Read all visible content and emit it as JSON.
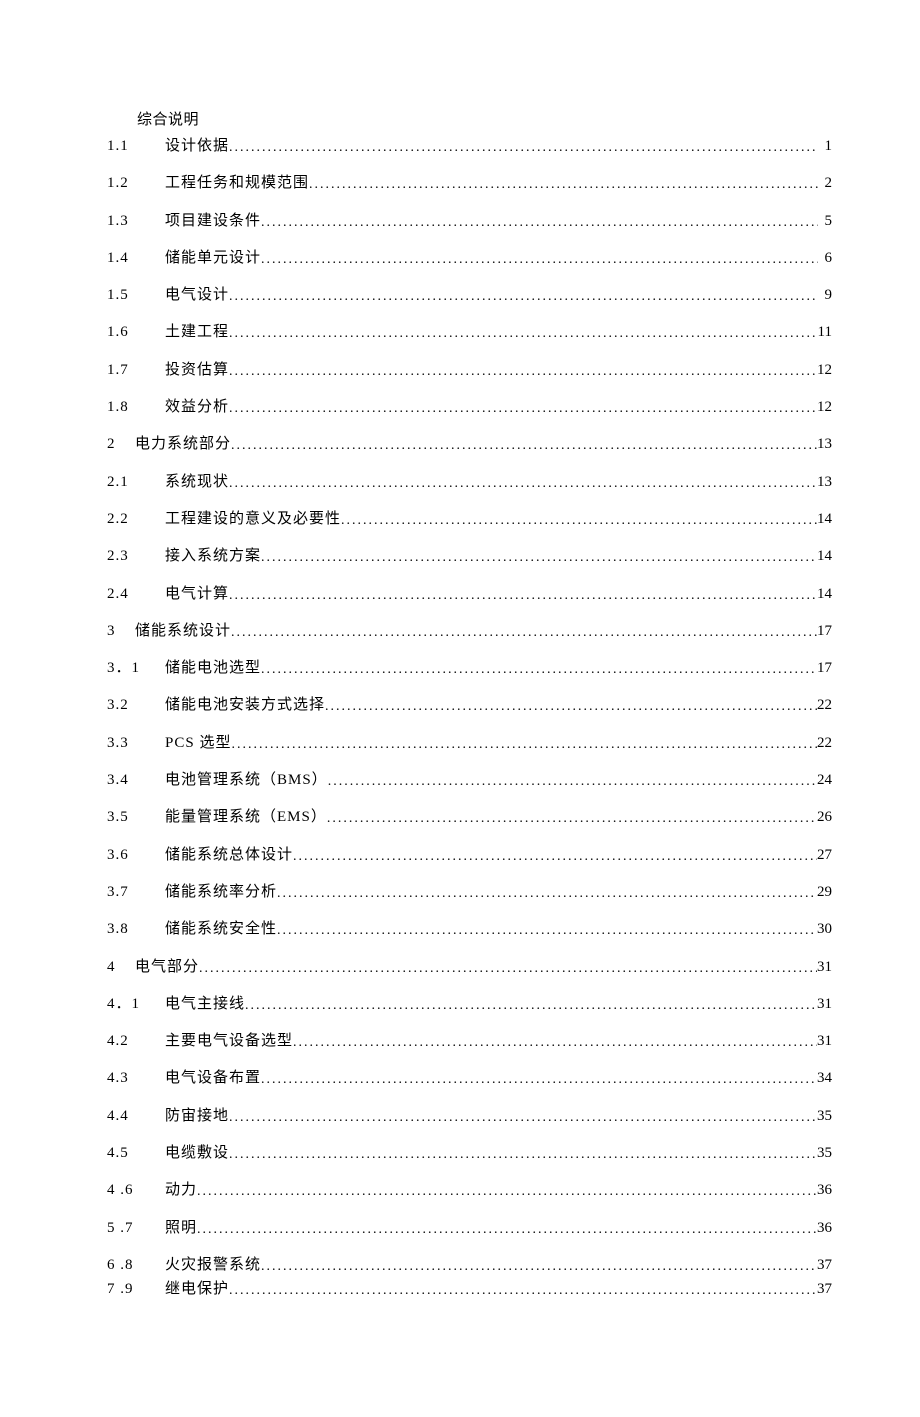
{
  "heading": "综合说明",
  "toc": [
    {
      "num": "1.1",
      "title": "设计依据",
      "page": "1",
      "type": "sub"
    },
    {
      "num": "1.2",
      "title": "工程任务和规模范围",
      "page": "2",
      "type": "sub"
    },
    {
      "num": "1.3",
      "title": "项目建设条件",
      "page": "5",
      "type": "sub"
    },
    {
      "num": "1.4",
      "title": "储能单元设计",
      "page": "6",
      "type": "sub"
    },
    {
      "num": "1.5",
      "title": "电气设计",
      "page": "9",
      "type": "sub"
    },
    {
      "num": "1.6",
      "title": "土建工程",
      "page": "11",
      "type": "sub"
    },
    {
      "num": "1.7",
      "title": "投资估算",
      "page": "12",
      "type": "sub"
    },
    {
      "num": "1.8",
      "title": "效益分析",
      "page": "12",
      "type": "sub"
    },
    {
      "num": "2",
      "title": "电力系统部分",
      "page": "13",
      "type": "section"
    },
    {
      "num": "2.1",
      "title": "系统现状",
      "page": "13",
      "type": "sub"
    },
    {
      "num": "2.2",
      "title": "工程建设的意义及必要性",
      "page": "14",
      "type": "sub"
    },
    {
      "num": "2.3",
      "title": "接入系统方案",
      "page": "14",
      "type": "sub"
    },
    {
      "num": "2.4",
      "title": "电气计算",
      "page": "14",
      "type": "sub"
    },
    {
      "num": "3",
      "title": "储能系统设计",
      "page": "17",
      "type": "section"
    },
    {
      "num": "3．1",
      "title": "储能电池选型",
      "page": "17",
      "type": "sub"
    },
    {
      "num": "3.2",
      "title": "储能电池安装方式选择",
      "page": "22",
      "type": "sub"
    },
    {
      "num": "3.3",
      "title": "PCS 选型",
      "page": "22",
      "type": "sub"
    },
    {
      "num": "3.4",
      "title": "电池管理系统（BMS）",
      "page": "24",
      "type": "sub"
    },
    {
      "num": "3.5",
      "title": "能量管理系统（EMS）",
      "page": "26",
      "type": "sub"
    },
    {
      "num": "3.6",
      "title": "储能系统总体设计",
      "page": "27",
      "type": "sub"
    },
    {
      "num": "3.7",
      "title": "储能系统率分析",
      "page": "29",
      "type": "sub"
    },
    {
      "num": "3.8",
      "title": "储能系统安全性",
      "page": "30",
      "type": "sub"
    },
    {
      "num": "4",
      "title": "电气部分",
      "page": "31",
      "type": "section"
    },
    {
      "num": "4．1",
      "title": "电气主接线",
      "page": "31",
      "type": "sub"
    },
    {
      "num": "4.2",
      "title": "主要电气设备选型",
      "page": "31",
      "type": "sub"
    },
    {
      "num": "4.3",
      "title": "电气设备布置",
      "page": "34",
      "type": "sub"
    },
    {
      "num": "4.4",
      "title": "防宙接地",
      "page": "35",
      "type": "sub"
    },
    {
      "num": "4.5",
      "title": "电缆敷设",
      "page": "35",
      "type": "sub"
    },
    {
      "num": "4 .6",
      "title": "动力",
      "page": "36",
      "type": "sub"
    },
    {
      "num": "5 .7",
      "title": "照明",
      "page": "36",
      "type": "sub"
    },
    {
      "num": "6 .8",
      "title": "火灾报警系统",
      "page": "37",
      "type": "sub",
      "klass": "last-pair"
    },
    {
      "num": "7 .9",
      "title": "继电保护",
      "page": "37",
      "type": "sub"
    }
  ]
}
